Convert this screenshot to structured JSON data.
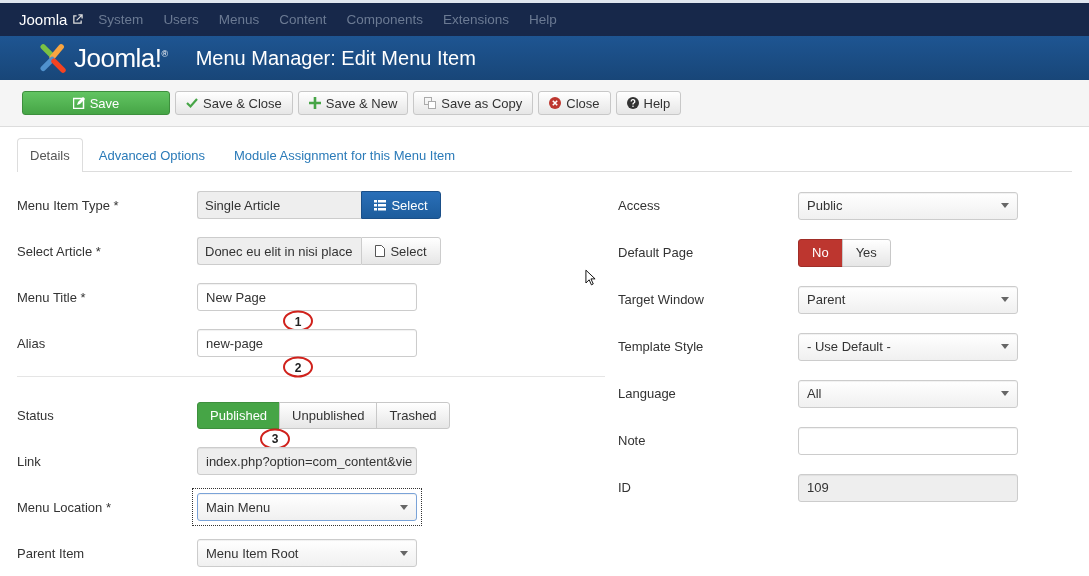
{
  "topnav": {
    "brand": "Joomla",
    "items": [
      "System",
      "Users",
      "Menus",
      "Content",
      "Components",
      "Extensions",
      "Help"
    ]
  },
  "header": {
    "logo_text": "Joomla!$^{®}$",
    "title": "Menu Manager: Edit Menu Item"
  },
  "toolbar": [
    {
      "label": "Save",
      "kind": "edit",
      "primary": true
    },
    {
      "label": "Save & Close",
      "kind": "check",
      "primary": false
    },
    {
      "label": "Save & New",
      "kind": "plus",
      "primary": false
    },
    {
      "label": "Save as Copy",
      "kind": "copy",
      "primary": false
    },
    {
      "label": "Close",
      "kind": "close",
      "primary": false
    },
    {
      "label": "Help",
      "kind": "help",
      "primary": false
    }
  ],
  "tabs": [
    {
      "label": "Details",
      "selected": true
    },
    {
      "label": "Advanced Options",
      "selected": false
    },
    {
      "label": "Module Assignment for this Menu Item",
      "selected": false
    }
  ],
  "left_top": [
    {
      "label": "Menu Item Type *",
      "kind": "picker",
      "value": "Single Article",
      "button": "Select",
      "button_primary": true
    },
    {
      "label": "Select Article *",
      "kind": "picker",
      "value": "Donec eu elit in nisi place",
      "button": "Select",
      "button_primary": false
    },
    {
      "label": "Menu Title *",
      "kind": "text",
      "value": "New Page",
      "annotation": "1"
    },
    {
      "label": "Alias",
      "kind": "text",
      "value": "new-page",
      "annotation": "2"
    }
  ],
  "left_bottom": [
    {
      "label": "Status",
      "kind": "toggle",
      "options": [
        {
          "label": "Published",
          "selected": true
        },
        {
          "label": "Unpublished",
          "selected": false
        },
        {
          "label": "Trashed",
          "selected": false
        }
      ],
      "annotation": "3"
    },
    {
      "label": "Link",
      "kind": "readonly",
      "value": "index.php?option=com_content&vie"
    },
    {
      "label": "Menu Location *",
      "kind": "select",
      "value": "Main Menu",
      "focused": true
    },
    {
      "label": "Parent Item",
      "kind": "select",
      "value": "Menu Item Root",
      "focused": false
    }
  ],
  "right": [
    {
      "label": "Access",
      "kind": "select",
      "value": "Public",
      "focused": false
    },
    {
      "label": "Default Page",
      "kind": "switch",
      "options": [
        {
          "label": "No",
          "selected": true
        },
        {
          "label": "Yes",
          "selected": false
        }
      ]
    },
    {
      "label": "Target Window",
      "kind": "select",
      "value": "Parent",
      "focused": false
    },
    {
      "label": "Template Style",
      "kind": "select",
      "value": "- Use Default -",
      "focused": false
    },
    {
      "label": "Language",
      "kind": "select",
      "value": "All",
      "focused": false
    },
    {
      "label": "Note",
      "kind": "text"
    },
    {
      "label": "ID",
      "kind": "readonly",
      "value": "109"
    }
  ]
}
